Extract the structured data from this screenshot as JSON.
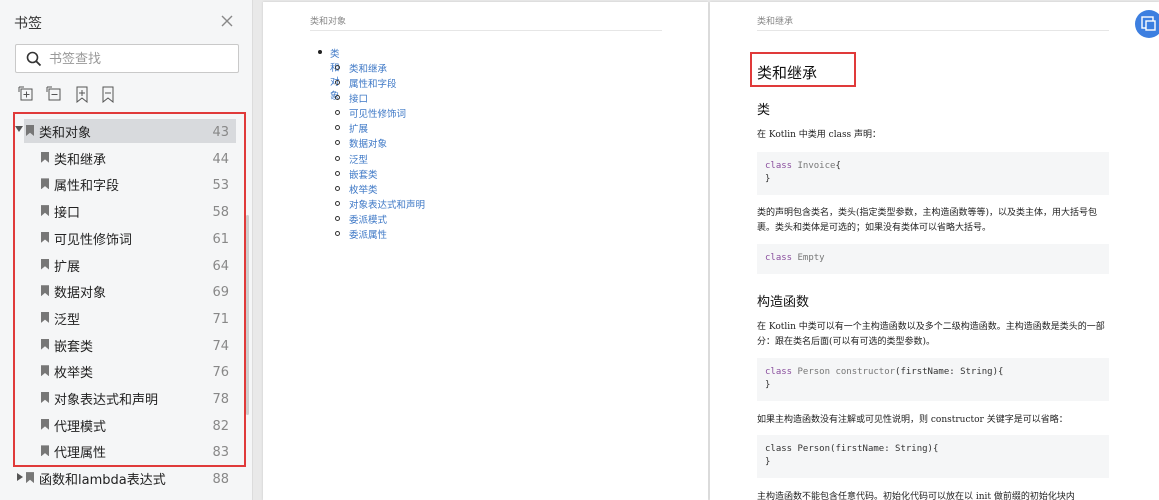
{
  "sidebar": {
    "title": "书签",
    "search_placeholder": "书签查找",
    "tools": [
      "expand-all-icon",
      "collapse-all-icon",
      "add-bookmark-icon",
      "remove-bookmark-icon"
    ],
    "items": [
      {
        "label": "类和对象",
        "page": "43",
        "level": 0,
        "expanded": true,
        "selected": true
      },
      {
        "label": "类和继承",
        "page": "44",
        "level": 1
      },
      {
        "label": "属性和字段",
        "page": "53",
        "level": 1
      },
      {
        "label": "接口",
        "page": "58",
        "level": 1
      },
      {
        "label": "可见性修饰词",
        "page": "61",
        "level": 1
      },
      {
        "label": "扩展",
        "page": "64",
        "level": 1
      },
      {
        "label": "数据对象",
        "page": "69",
        "level": 1
      },
      {
        "label": "泛型",
        "page": "71",
        "level": 1
      },
      {
        "label": "嵌套类",
        "page": "74",
        "level": 1
      },
      {
        "label": "枚举类",
        "page": "76",
        "level": 1
      },
      {
        "label": "对象表达式和声明",
        "page": "78",
        "level": 1
      },
      {
        "label": "代理模式",
        "page": "82",
        "level": 1
      },
      {
        "label": "代理属性",
        "page": "83",
        "level": 1
      },
      {
        "label": "函数和lambda表达式",
        "page": "88",
        "level": 0,
        "expanded": false
      }
    ]
  },
  "left_page": {
    "running_head": "类和对象",
    "toc_top": "类和对象",
    "toc_items": [
      "类和继承",
      "属性和字段",
      "接口",
      "可见性修饰词",
      "扩展",
      "数据对象",
      "泛型",
      "嵌套类",
      "枚举类",
      "对象表达式和声明",
      "委派模式",
      "委派属性"
    ]
  },
  "right_page": {
    "running_head": "类和继承",
    "h1": "类和继承",
    "h2_class": "类",
    "p1": "在 Kotlin 中类用 class 声明：",
    "code1_kw": "class",
    "code1_name": " Invoice",
    "code1_rest": "{",
    "code1_close": "}",
    "p2": "类的声明包含类名，类头(指定类型参数，主构造函数等等)，以及类主体，用大括号包裹。类头和类体是可选的；如果没有类体可以省略大括号。",
    "code2_kw": "class",
    "code2_name": " Empty",
    "h2_ctor": "构造函数",
    "p3": "在 Kotlin 中类可以有一个主构造函数以及多个二级构造函数。主构造函数是类头的一部分：跟在类名后面(可以有可选的类型参数)。",
    "code3_kw": "class",
    "code3_name": " Person constructor",
    "code3_rest": "(firstName: String){",
    "code3_close": "}",
    "p4": "如果主构造函数没有注解或可见性说明，则 constructor 关键字是可以省略：",
    "code4_line1": "class Person(firstName: String){",
    "code4_close": "}",
    "p5": "主构造函数不能包含任意代码。初始化代码可以放在以 init 做前缀的初始化块内"
  },
  "colors": {
    "highlight": "#e03a3a",
    "link": "#3e78c6",
    "accent": "#3d7fe0"
  }
}
